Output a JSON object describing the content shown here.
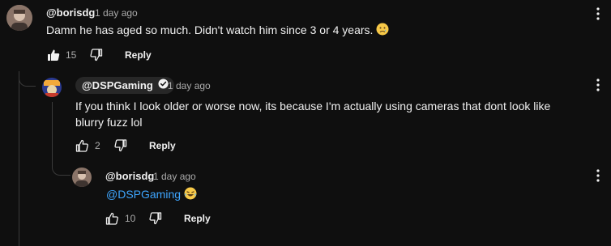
{
  "comment": {
    "author": "@borisdg",
    "time": "1 day ago",
    "text": "Damn he has aged so much. Didn't watch him since 3 or 4 years.",
    "likes": "15",
    "reply_label": "Reply",
    "emoji_icon": "sad-tear-emoji"
  },
  "reply1": {
    "author": "@DSPGaming",
    "verified_icon": "verified-check-icon",
    "time": "1 day ago",
    "text": "If you think I look older or worse now, its because I'm actually using cameras that dont look like blurry fuzz lol",
    "likes": "2",
    "reply_label": "Reply"
  },
  "reply2": {
    "author": "@borisdg",
    "time": "1 day ago",
    "mention": "@DSPGaming",
    "emoji_icon": "laughing-emoji",
    "likes": "10",
    "reply_label": "Reply"
  },
  "colors": {
    "background": "#0f0f0f",
    "text": "#f1f1f1",
    "muted": "#aaaaaa",
    "mention": "#3ea6ff",
    "pill": "#272727"
  }
}
